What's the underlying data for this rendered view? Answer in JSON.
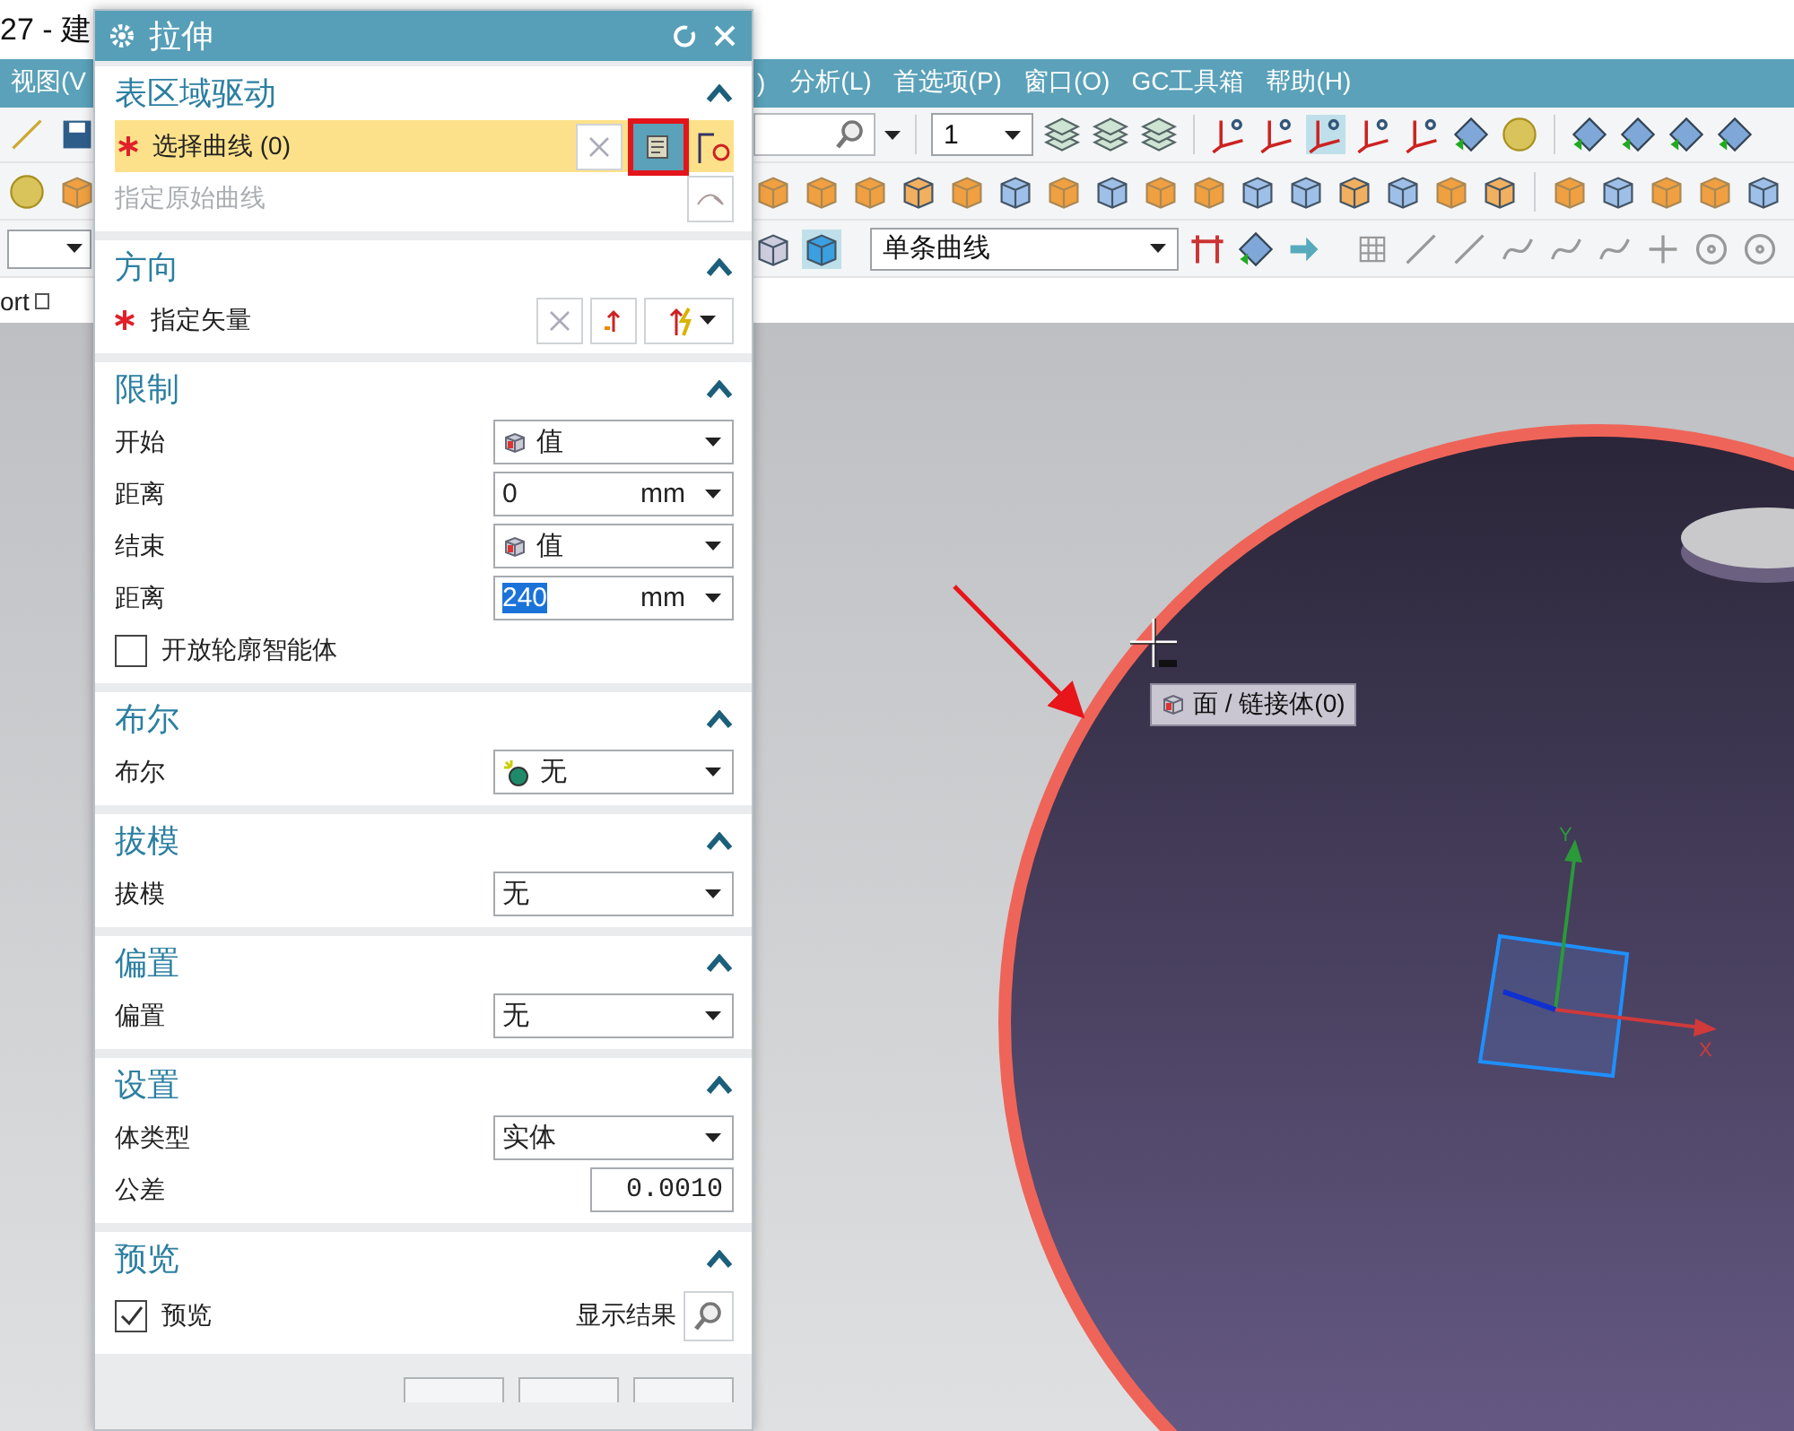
{
  "app": {
    "title": "27 - 建",
    "menus": [
      {
        "label": "视图(V"
      },
      {
        "label": ")"
      },
      {
        "label": "分析(L)"
      },
      {
        "label": "首选项(P)"
      },
      {
        "label": "窗口(O)"
      },
      {
        "label": "GC工具箱"
      },
      {
        "label": "帮助(H)"
      }
    ],
    "toolbar": {
      "layer_value": "1",
      "filter_value": "单条曲线"
    },
    "tab": {
      "label": "ort"
    }
  },
  "viewport": {
    "tooltip": "面 / 链接体(0)",
    "axis_x": "X",
    "axis_y": "Y"
  },
  "dialog": {
    "title": "拉伸",
    "sections": [
      {
        "title": "表区域驱动",
        "expanded": true,
        "rows": [
          {
            "kind": "selection",
            "label": "选择曲线 (0)",
            "required": true,
            "active": true,
            "marked": true
          },
          {
            "kind": "reference",
            "label": "指定原始曲线",
            "required": false,
            "disabled": true
          }
        ]
      },
      {
        "title": "方向",
        "expanded": true,
        "rows": [
          {
            "kind": "vector",
            "label": "指定矢量",
            "required": true
          }
        ]
      },
      {
        "title": "限制",
        "expanded": true,
        "rows": [
          {
            "kind": "method-dropdown",
            "label": "开始",
            "value": "值"
          },
          {
            "kind": "unit-field",
            "label": "距离",
            "value": "0",
            "unit": "mm",
            "selected": false
          },
          {
            "kind": "method-dropdown",
            "label": "结束",
            "value": "值"
          },
          {
            "kind": "unit-field",
            "label": "距离",
            "value": "240",
            "unit": "mm",
            "selected": true
          },
          {
            "kind": "checkbox",
            "label": "开放轮廓智能体",
            "checked": false
          }
        ]
      },
      {
        "title": "布尔",
        "expanded": true,
        "rows": [
          {
            "kind": "boolean-dropdown",
            "label": "布尔",
            "value": "无"
          }
        ]
      },
      {
        "title": "拔模",
        "expanded": true,
        "rows": [
          {
            "kind": "dropdown",
            "label": "拔模",
            "value": "无"
          }
        ]
      },
      {
        "title": "偏置",
        "expanded": true,
        "rows": [
          {
            "kind": "dropdown",
            "label": "偏置",
            "value": "无"
          }
        ]
      },
      {
        "title": "设置",
        "expanded": true,
        "rows": [
          {
            "kind": "dropdown",
            "label": "体类型",
            "value": "实体"
          },
          {
            "kind": "number-field",
            "label": "公差",
            "value": "0.0010"
          }
        ]
      },
      {
        "title": "预览",
        "expanded": true,
        "rows": [
          {
            "kind": "preview",
            "label": "预览",
            "checked": true,
            "button": "显示结果"
          }
        ]
      }
    ]
  }
}
